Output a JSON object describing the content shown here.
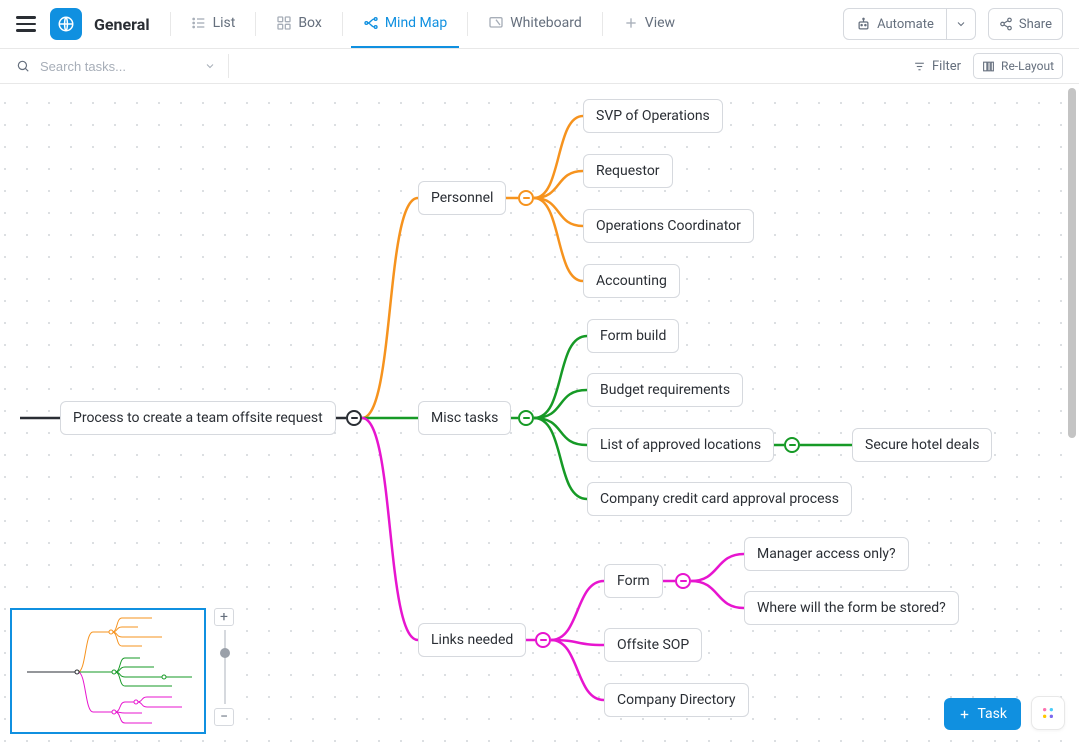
{
  "header": {
    "title": "General",
    "tabs": {
      "list": "List",
      "box": "Box",
      "mindmap": "Mind Map",
      "whiteboard": "Whiteboard",
      "view": "View"
    },
    "automate": "Automate",
    "share": "Share"
  },
  "subbar": {
    "search_placeholder": "Search tasks...",
    "filter": "Filter",
    "relayout": "Re-Layout"
  },
  "mindmap": {
    "root": "Process to create a team offsite request",
    "branch1": {
      "label": "Personnel",
      "children": [
        "SVP of Operations",
        "Requestor",
        "Operations Coordinator",
        "Accounting"
      ]
    },
    "branch2": {
      "label": "Misc tasks",
      "children": [
        "Form build",
        "Budget requirements",
        "List of approved locations",
        "Company credit card approval process"
      ],
      "grandchild": "Secure hotel deals"
    },
    "branch3": {
      "label": "Links needed",
      "children": [
        "Form",
        "Offsite SOP",
        "Company Directory"
      ],
      "form_children": [
        "Manager access only?",
        "Where will the form be stored?"
      ]
    }
  },
  "colors": {
    "orange": "#f6931e",
    "green": "#169a26",
    "pink": "#e715cf",
    "blue": "#1090e0"
  },
  "footer": {
    "task": "Task"
  }
}
